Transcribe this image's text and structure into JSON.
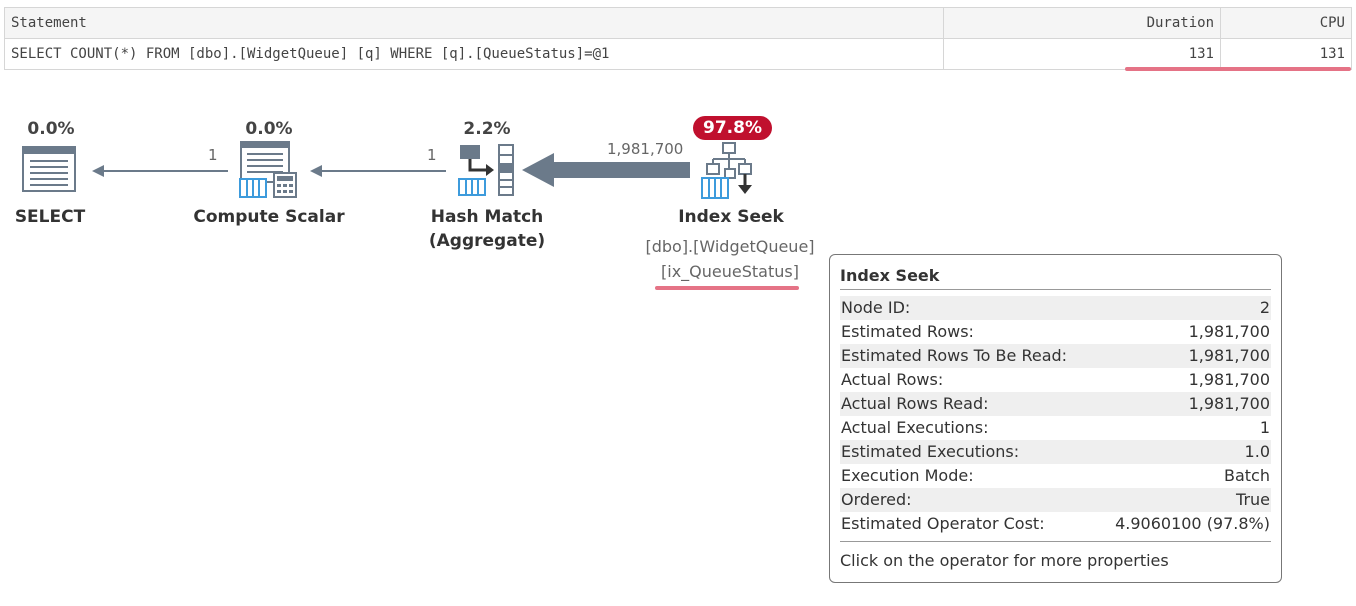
{
  "grid": {
    "headers": {
      "statement": "Statement",
      "duration": "Duration",
      "cpu": "CPU"
    },
    "row": {
      "statement": "SELECT COUNT(*) FROM [dbo].[WidgetQueue] [q] WHERE [q].[QueueStatus]=@1",
      "duration": "131",
      "cpu": "131"
    }
  },
  "plan": {
    "operators": [
      {
        "name": "SELECT",
        "pct": "0.0%"
      },
      {
        "name": "Compute Scalar",
        "pct": "0.0%"
      },
      {
        "name_line1": "Hash Match",
        "name_line2": "(Aggregate)",
        "pct": "2.2%"
      },
      {
        "name": "Index Seek",
        "pct": "97.8%",
        "object": "[dbo].[WidgetQueue]",
        "index": "[ix_QueueStatus]"
      }
    ],
    "arrows": [
      {
        "rows": "1"
      },
      {
        "rows": "1"
      },
      {
        "rows": "1,981,700"
      }
    ]
  },
  "tooltip": {
    "title": "Index Seek",
    "rows": [
      {
        "label": "Node ID:",
        "value": "2"
      },
      {
        "label": "Estimated Rows:",
        "value": "1,981,700"
      },
      {
        "label": "Estimated Rows To Be Read:",
        "value": "1,981,700"
      },
      {
        "label": "Actual Rows:",
        "value": "1,981,700"
      },
      {
        "label": "Actual Rows Read:",
        "value": "1,981,700"
      },
      {
        "label": "Actual Executions:",
        "value": "1"
      },
      {
        "label": "Estimated Executions:",
        "value": "1.0"
      },
      {
        "label": "Execution Mode:",
        "value": "Batch"
      },
      {
        "label": "Ordered:",
        "value": "True"
      },
      {
        "label": "Estimated Operator Cost:",
        "value": "4.9060100 (97.8%)"
      }
    ],
    "footer": "Click on the operator for more properties"
  },
  "colors": {
    "highlight_underline": "#e57386",
    "cost_badge": "#c0102e",
    "icon_blue": "#3d9bdc",
    "icon_gray": "#6b7a8a"
  },
  "icons": [
    "select-icon",
    "compute-scalar-icon",
    "hash-match-icon",
    "index-seek-icon"
  ]
}
